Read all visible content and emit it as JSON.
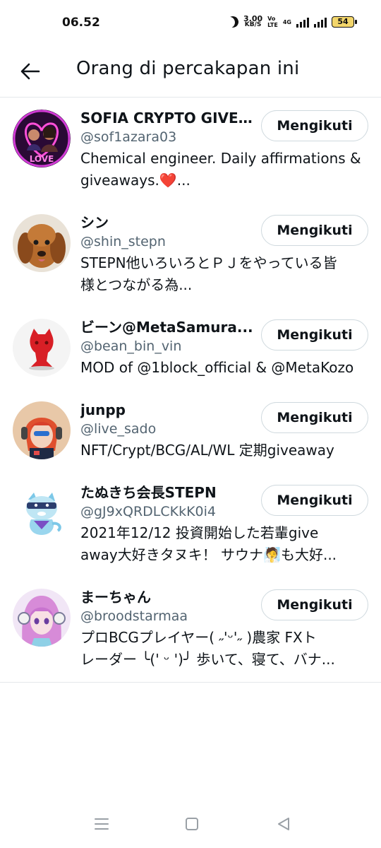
{
  "status_bar": {
    "time": "06.52",
    "speed_value": "3.00",
    "speed_unit": "KB/S",
    "volte_top": "Vo",
    "volte_bottom": "LTE",
    "network": "4G",
    "battery": "54"
  },
  "header": {
    "title": "Orang di percakapan ini"
  },
  "people": [
    {
      "name": "SOFIA CRYPTO GIVE...",
      "handle": "@sof1azara03",
      "bio": [
        "Chemical engineer. Daily affirmations &",
        "giveaways.❤️..."
      ],
      "button": "Mengikuti",
      "avatar": "avatar-sofia-crypto"
    },
    {
      "name": "シン",
      "handle": "@shin_stepn",
      "bio": [
        "STEPN他いろいろとＰＪをやっている皆",
        "様とつながる為..."
      ],
      "button": "Mengikuti",
      "avatar": "avatar-dog"
    },
    {
      "name": "ビーン@MetaSamura...",
      "handle": "@bean_bin_vin",
      "bio": [
        "MOD of @1block_official & @MetaKozo"
      ],
      "button": "Mengikuti",
      "avatar": "avatar-red-figure"
    },
    {
      "name": "junpp",
      "handle": "@live_sado",
      "bio": [
        "NFT/Crypt/BCG/AL/WL 定期giveaway"
      ],
      "button": "Mengikuti",
      "avatar": "avatar-anime-headphones"
    },
    {
      "name": "たぬきち会長STEPN",
      "handle": "@gJ9xQRDLCKkK0i4",
      "bio": [
        "2021年12/12 投資開始した若輩give",
        "away大好きタヌキ！ サウナ🧖も大好..."
      ],
      "button": "Mengikuti",
      "avatar": "avatar-tanuki-mascot"
    },
    {
      "name": "まーちゃん",
      "handle": "@broodstarmaa",
      "bio": [
        "プロBCGプレイヤー( ˶'ᵕ'˶ )農家 FXト",
        "レーダー ╰(' ᵕ ')╯ 歩いて、寝て、バナ..."
      ],
      "button": "Mengikuti",
      "avatar": "avatar-anime-girl"
    }
  ],
  "nav": {
    "menu": "menu-icon",
    "home": "home-square-icon",
    "back": "back-triangle-icon"
  },
  "colors": {
    "text": "#0f1419",
    "secondary": "#536471",
    "border": "#cfd9de",
    "divider": "#e4e8eb"
  }
}
